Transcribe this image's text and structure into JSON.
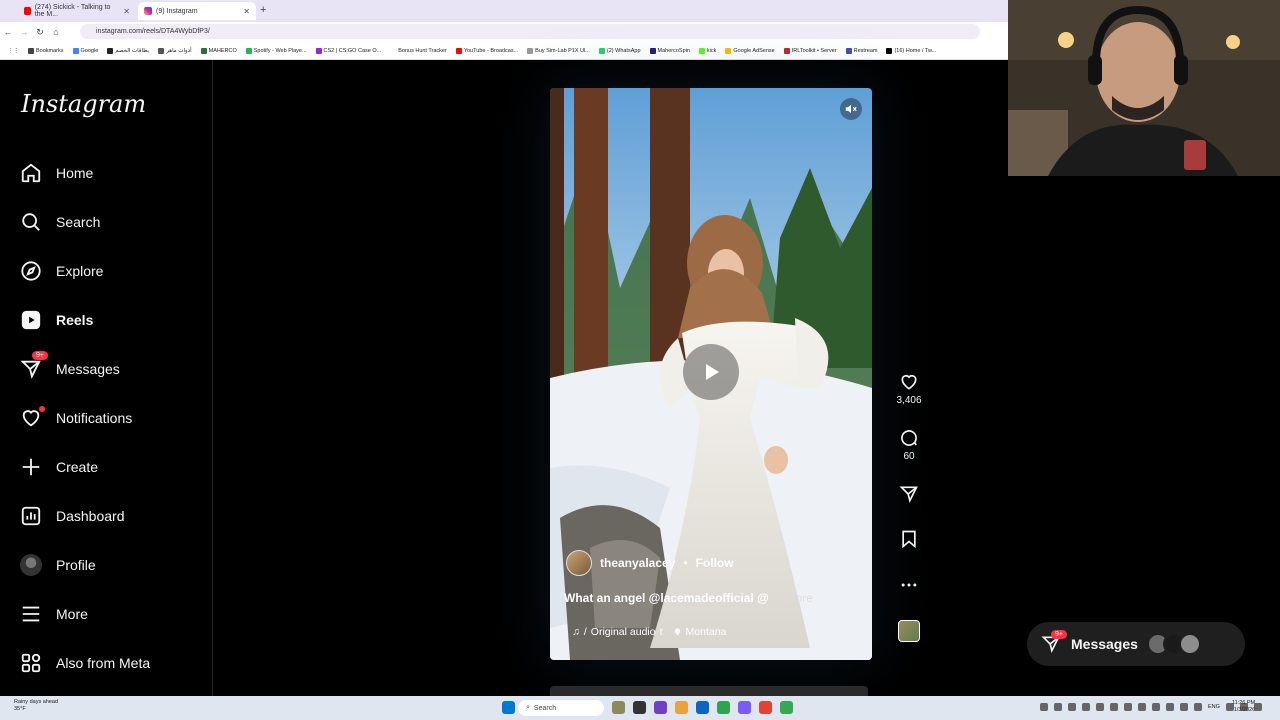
{
  "browser": {
    "tabs": [
      {
        "title": "(274) Sickick - Talking to the M...",
        "active": false,
        "icon_color": "#ff0000"
      },
      {
        "title": "(9) Instagram",
        "active": true,
        "icon_color": "#d6249f"
      }
    ],
    "url": "instagram.com/reels/DTA4WybDfP3/",
    "bookmarks": [
      {
        "label": "Bookmarks",
        "color": "#444444"
      },
      {
        "label": "Google",
        "color": "#4285f4"
      },
      {
        "label": "بطاقات الخصم",
        "color": "#222222"
      },
      {
        "label": "أدوات ماهر",
        "color": "#555555"
      },
      {
        "label": "MAHERCO",
        "color": "#2a6f3a"
      },
      {
        "label": "Spotify - Web Playe...",
        "color": "#1db954"
      },
      {
        "label": "CS2 | CS:GO Case O...",
        "color": "#8a2be2"
      },
      {
        "label": "Bonus Hunt Tracker",
        "color": "#ffffff"
      },
      {
        "label": "YouTube - Broadcas...",
        "color": "#ff0000"
      },
      {
        "label": "Buy Sim-Lab P1X Ul...",
        "color": "#999999"
      },
      {
        "label": "(2) WhatsApp",
        "color": "#25d366"
      },
      {
        "label": "MahercoSpin",
        "color": "#1a237e"
      },
      {
        "label": "kick",
        "color": "#53fc18"
      },
      {
        "label": "Google AdSense",
        "color": "#fbbc04"
      },
      {
        "label": "IRLToolkit • Server",
        "color": "#c62828"
      },
      {
        "label": "Restream",
        "color": "#3f51b5"
      },
      {
        "label": "(16) Home / Tw...",
        "color": "#000000"
      }
    ]
  },
  "instagram": {
    "logo": "Instagram",
    "nav": [
      {
        "label": "Home",
        "icon": "home-icon"
      },
      {
        "label": "Search",
        "icon": "search-icon"
      },
      {
        "label": "Explore",
        "icon": "compass-icon"
      },
      {
        "label": "Reels",
        "icon": "reels-icon"
      },
      {
        "label": "Messages",
        "icon": "messenger-icon",
        "badge": "9+"
      },
      {
        "label": "Notifications",
        "icon": "heart-icon"
      },
      {
        "label": "Create",
        "icon": "plus-icon"
      },
      {
        "label": "Dashboard",
        "icon": "dashboard-icon"
      },
      {
        "label": "Profile",
        "icon": "avatar"
      },
      {
        "label": "More",
        "icon": "menu-icon"
      },
      {
        "label": "Also from Meta",
        "icon": "meta-apps-icon"
      }
    ],
    "reel": {
      "username": "theanyalacey",
      "separator": "•",
      "follow": "Follow",
      "caption": "What an angel @lacemadeofficial @",
      "caption_more": "... more",
      "audio": "Original audio",
      "audio_prefix": "/",
      "audio_suffix": "t",
      "location": "Montana",
      "likes": "3,406",
      "comments": "60"
    },
    "messages_pill": {
      "label": "Messages",
      "badge": "9+"
    }
  },
  "taskbar": {
    "weather": "Rainy days ahead",
    "temp": "35°F",
    "search_placeholder": "Search",
    "lang": "ENG",
    "time": "11:26 PM",
    "date": "1/3/2026",
    "app_colors": [
      "#0078d4",
      "#333333",
      "#e8a33d",
      "#6e40c9",
      "#f7c948",
      "#2ea44f",
      "#0a66c2",
      "#7a5af8",
      "#e34133",
      "#34a853"
    ]
  }
}
